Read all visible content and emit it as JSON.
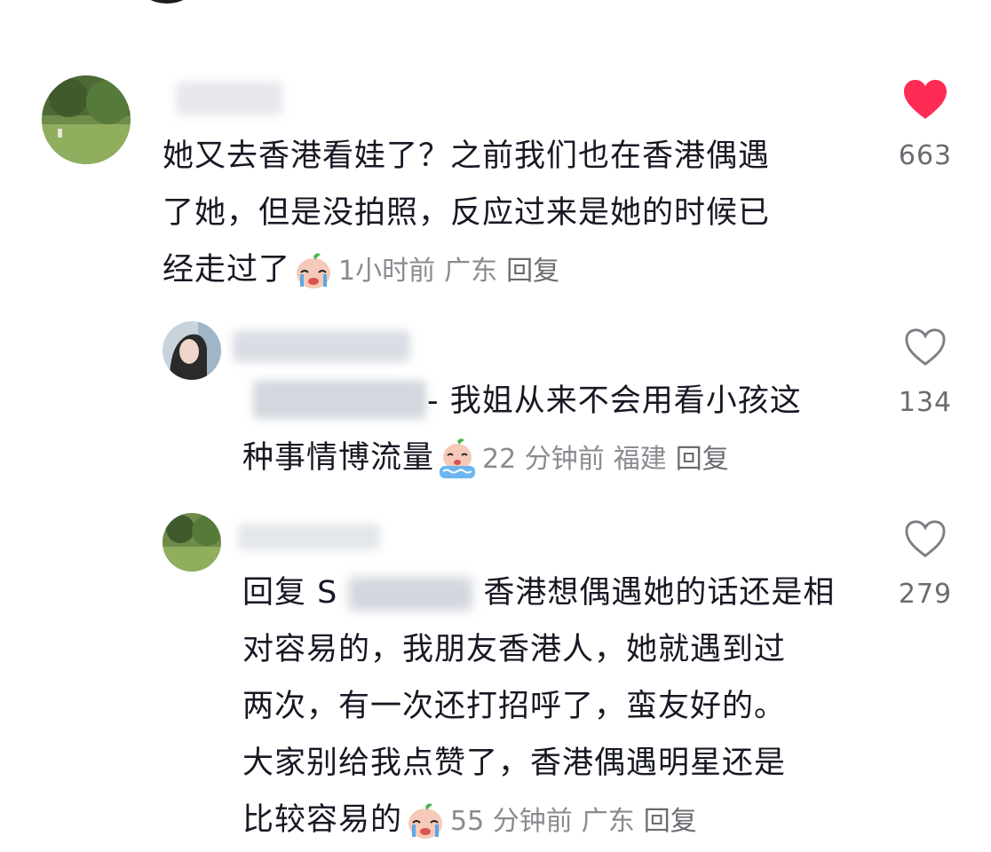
{
  "comments": [
    {
      "lines": [
        "她又去香港看娃了？之前我们也在香港偶遇",
        "了她，但是没拍照，反应过来是她的时候已",
        "经走过了"
      ],
      "time": "1小时前",
      "location": "广东",
      "reply_label": "回复",
      "likes": "663",
      "liked": true,
      "emoji": "crying-face-emoji"
    },
    {
      "lines": [
        "- 我姐从来不会用看小孩这",
        "种事情博流量"
      ],
      "time": "22 分钟前",
      "location": "福建",
      "reply_label": "回复",
      "likes": "134",
      "liked": false,
      "emoji": "crying-in-pool-emoji"
    },
    {
      "reply_prefix": "回复 S",
      "lines": [
        "香港想偶遇她的话还是相",
        "对容易的，我朋友香港人，她就遇到过",
        "两次，有一次还打招呼了，蛮友好的。",
        "大家别给我点赞了，香港偶遇明星还是",
        "比较容易的"
      ],
      "time": "55 分钟前",
      "location": "广东",
      "reply_label": "回复",
      "likes": "279",
      "liked": false,
      "emoji": "crying-face-emoji"
    }
  ],
  "colors": {
    "liked_heart": "#fe2c55",
    "meta_text": "#8a8b91",
    "body_text": "#161823"
  }
}
